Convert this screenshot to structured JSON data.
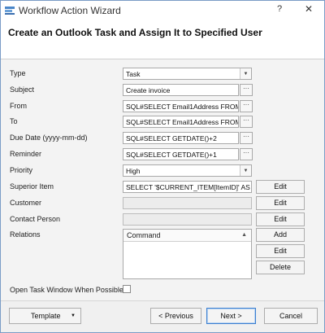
{
  "window": {
    "title": "Workflow Action Wizard",
    "help_label": "?",
    "close_label": "✕",
    "accent_color": "#4a86c8"
  },
  "header": {
    "title": "Create an Outlook Task and Assign It to Specified User"
  },
  "form": {
    "type": {
      "label": "Type",
      "value": "Task"
    },
    "subject": {
      "label": "Subject",
      "value": "Create invoice"
    },
    "from": {
      "label": "From",
      "value": "SQL#SELECT Email1Address FROM"
    },
    "to": {
      "label": "To",
      "value": "SQL#SELECT Email1Address FROM"
    },
    "due_date": {
      "label": "Due Date (yyyy-mm-dd)",
      "value": "SQL#SELECT GETDATE()+2"
    },
    "reminder": {
      "label": "Reminder",
      "value": "SQL#SELECT GETDATE()+1"
    },
    "priority": {
      "label": "Priority",
      "value": "High"
    },
    "superior_item": {
      "label": "Superior Item",
      "value": "SELECT '$CURRENT_ITEM[ItemID]' AS"
    },
    "customer": {
      "label": "Customer",
      "value": ""
    },
    "contact_person": {
      "label": "Contact Person",
      "value": ""
    },
    "relations": {
      "label": "Relations",
      "column_header": "Command"
    },
    "open_task": {
      "label": "Open Task Window When Possible",
      "checked": false
    },
    "ellipsis_label": "···",
    "edit_label": "Edit",
    "add_label": "Add",
    "delete_label": "Delete"
  },
  "footer": {
    "template_label": "Template",
    "previous_label": "< Previous",
    "next_label": "Next >",
    "cancel_label": "Cancel"
  }
}
